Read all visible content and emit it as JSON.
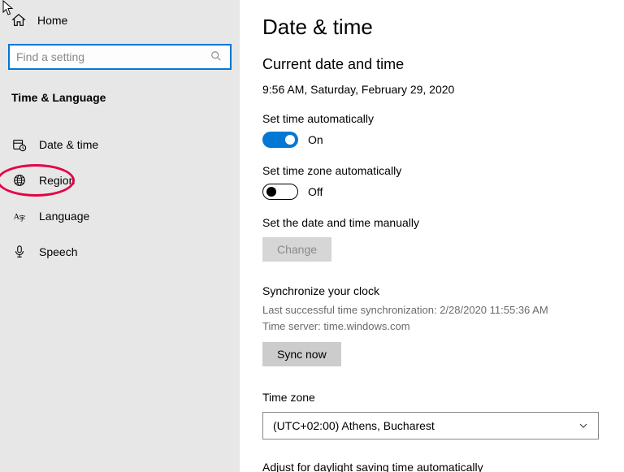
{
  "sidebar": {
    "home": "Home",
    "search_placeholder": "Find a setting",
    "category": "Time & Language",
    "items": [
      {
        "label": "Date & time"
      },
      {
        "label": "Region"
      },
      {
        "label": "Language"
      },
      {
        "label": "Speech"
      }
    ]
  },
  "main": {
    "title": "Date & time",
    "current_section": "Current date and time",
    "current_value": "9:56 AM, Saturday, February 29, 2020",
    "set_time_auto_label": "Set time automatically",
    "set_time_auto_state": "On",
    "set_tz_auto_label": "Set time zone automatically",
    "set_tz_auto_state": "Off",
    "manual_label": "Set the date and time manually",
    "change_btn": "Change",
    "sync_title": "Synchronize your clock",
    "sync_last": "Last successful time synchronization: 2/28/2020 11:55:36 AM",
    "sync_server": "Time server: time.windows.com",
    "sync_btn": "Sync now",
    "tz_label": "Time zone",
    "tz_value": "(UTC+02:00) Athens, Bucharest",
    "dst_label": "Adjust for daylight saving time automatically"
  }
}
